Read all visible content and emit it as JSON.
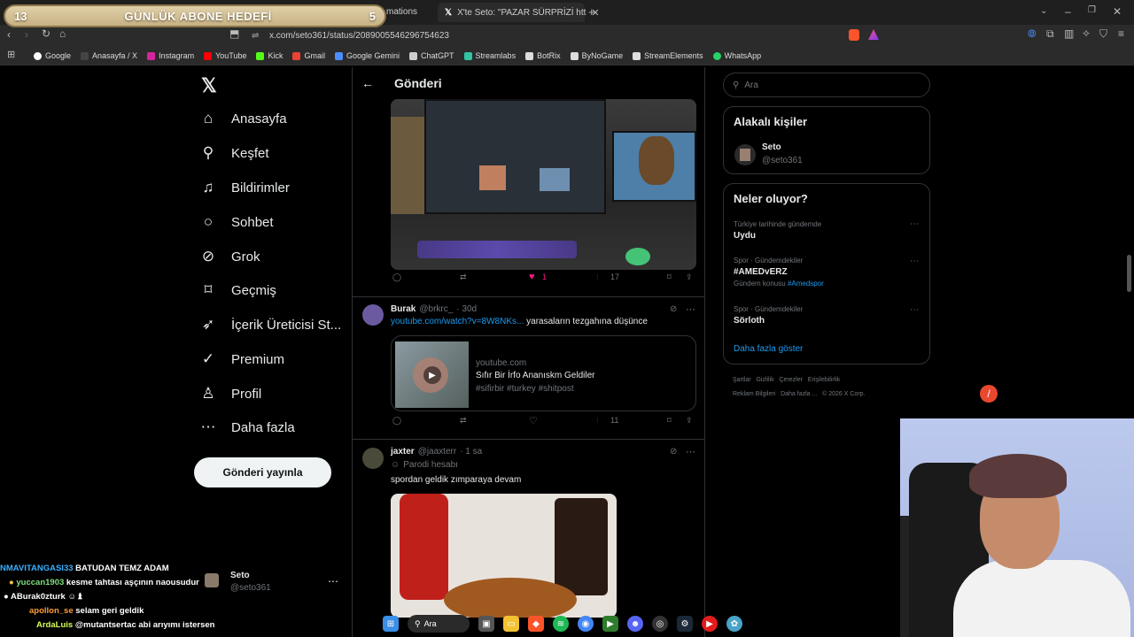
{
  "overlay": {
    "goal_left": "13",
    "goal_title": "GÜNLÜK ABONE HEDEFİ",
    "goal_right": "5"
  },
  "browser": {
    "tab_prev_text": "mations",
    "tab_active_title": "X'te Seto: \"PAZAR SÜRPRİZİ htt",
    "url": "x.com/seto361/status/2089005546296754623",
    "bookmarks": [
      "Google",
      "Anasayfa / X",
      "Instagram",
      "YouTube",
      "Kick",
      "Gmail",
      "Google Gemini",
      "ChatGPT",
      "Streamlabs",
      "BotRix",
      "ByNoGame",
      "StreamElements",
      "WhatsApp"
    ]
  },
  "nav": {
    "items": [
      {
        "label": "Anasayfa",
        "icon": "home-icon"
      },
      {
        "label": "Keşfet",
        "icon": "search-icon"
      },
      {
        "label": "Bildirimler",
        "icon": "bell-icon"
      },
      {
        "label": "Sohbet",
        "icon": "chat-icon"
      },
      {
        "label": "Grok",
        "icon": "grok-icon"
      },
      {
        "label": "Geçmiş",
        "icon": "bookmark-icon"
      },
      {
        "label": "İçerik Üreticisi St...",
        "icon": "rocket-icon"
      },
      {
        "label": "Premium",
        "icon": "verified-icon"
      },
      {
        "label": "Profil",
        "icon": "person-icon"
      },
      {
        "label": "Daha fazla",
        "icon": "more-circle-icon"
      }
    ],
    "post_button": "Gönderi yayınla",
    "account_name": "Seto",
    "account_handle": "@seto361"
  },
  "center": {
    "header_title": "Gönderi",
    "post1_actions": {
      "likes": "1",
      "views": "17"
    },
    "reply1": {
      "name": "Burak",
      "handle": "@brkrc_",
      "time": "· 30d",
      "link": "youtube.com/watch?v=8W8NKs...",
      "text": "yarasaların tezgahına düşünce",
      "card_domain": "youtube.com",
      "card_title": "Sıfır Bir İrfo Ananıskm Geldiler",
      "card_tags": "#sifirbir #turkey #shitpost",
      "views": "11"
    },
    "reply2": {
      "name": "jaxter",
      "handle": "@jaaxterr",
      "time": "· 1 sa",
      "badge": "Parodi hesabı",
      "text": "spordan geldik zımparaya devam"
    }
  },
  "right": {
    "search_placeholder": "Ara",
    "related_title": "Alakalı kişiler",
    "related_name": "Seto",
    "related_handle": "@seto361",
    "trends_title": "Neler oluyor?",
    "trends": [
      {
        "context": "Türkiye tarihinde gündemde",
        "name": "Uydu",
        "extra": "",
        "extra_link": ""
      },
      {
        "context": "Spor · Gündemdekiler",
        "name": "#AMEDvERZ",
        "extra": "Gündem konusu",
        "extra_link": "#Amedspor"
      },
      {
        "context": "Spor · Gündemdekiler",
        "name": "Sörloth",
        "extra": "",
        "extra_link": ""
      }
    ],
    "show_more": "Daha fazla göster",
    "footer_line1": "Şartlar   Gizlilik   Çerezler   Erişilebilirlik",
    "footer_line2": "Reklam Bilgileri   Daha fazla ...   © 2026 X Corp."
  },
  "chat": [
    {
      "user": "NMAVITANGASI33",
      "msg": "BATUDAN TEMZ ADAM",
      "color": "#3ab0ff"
    },
    {
      "user": "yuccan1903",
      "msg": "kesme tahtası aşçının naousudur",
      "color": "#7fe07f"
    },
    {
      "user": "ABurak0zturk",
      "msg": "",
      "color": "#ffffff"
    },
    {
      "user": "apollon_se",
      "msg": "selam geri geldik",
      "color": "#ff9a3a"
    },
    {
      "user": "ArdaLuis",
      "msg": "@mutantsertac abi arıyımı istersen",
      "color": "#d6ff5a"
    }
  ],
  "taskbar": {
    "search_label": "Ara"
  }
}
